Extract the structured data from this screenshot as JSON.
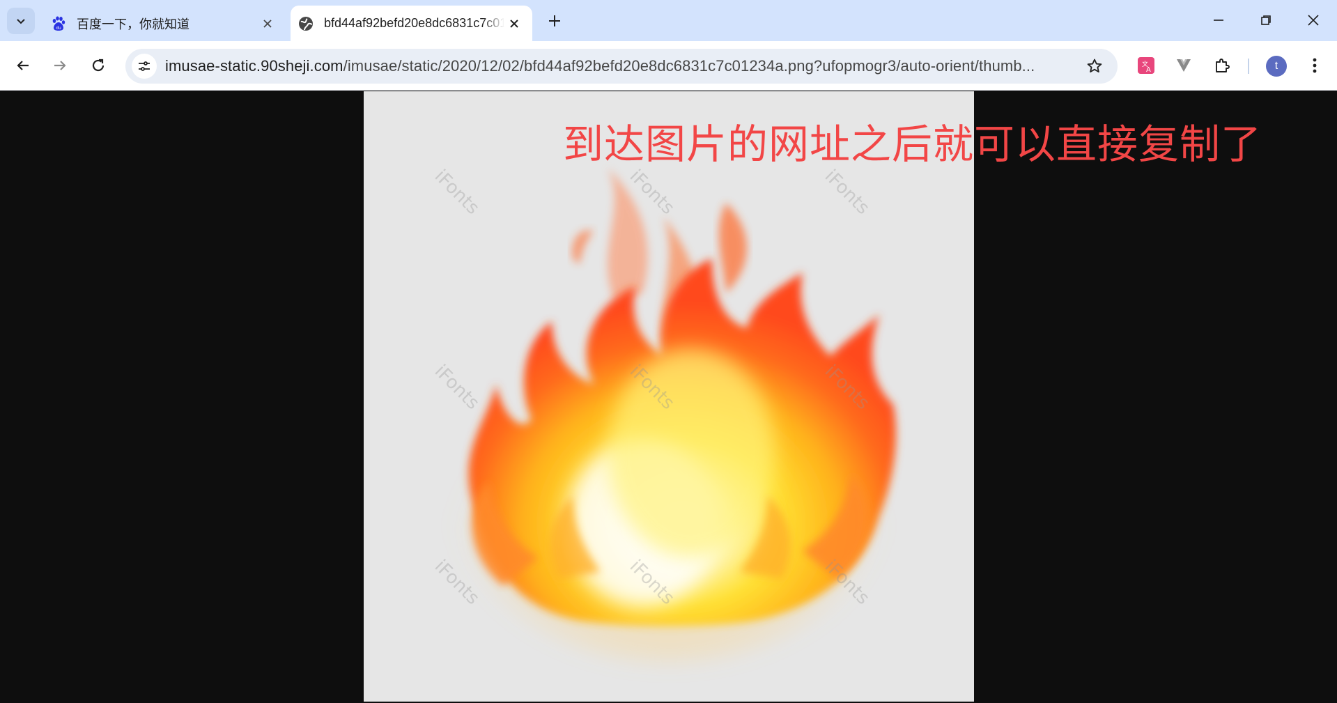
{
  "tabs": [
    {
      "title": "百度一下，你就知道",
      "favicon": "baidu-paw-icon",
      "active": false
    },
    {
      "title": "bfd44af92befd20e8dc6831c7c01234a.png",
      "favicon": "globe-icon",
      "active": true
    }
  ],
  "address_bar": {
    "host": "imusae-static.90sheji.com",
    "path": "/imusae/static/2020/12/02/bfd44af92befd20e8dc6831c7c01234a.png?ufopmogr3/auto-orient/thumb..."
  },
  "profile": {
    "initial": "t",
    "color": "#5b6bc0"
  },
  "image": {
    "watermark_text": "iFonts",
    "background_color": "#e6e6e6"
  },
  "annotation": {
    "text": "到达图片的网址之后就可以直接复制了",
    "color": "#f24646"
  },
  "colors": {
    "tabstrip": "#d3e3fd",
    "omnibox": "#e9eef6",
    "viewport": "#0e0e0e"
  }
}
